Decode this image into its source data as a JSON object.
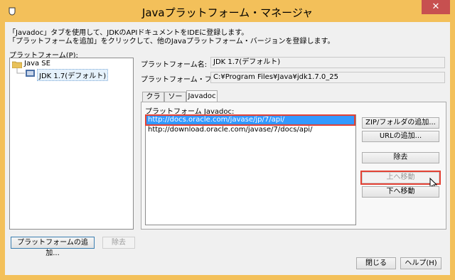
{
  "window": {
    "title": "Javaプラットフォーム・マネージャ",
    "close_glyph": "✕"
  },
  "instructions": {
    "line1": "「Javadoc」タブを使用して、JDKのAPIドキュメントをIDEに登録します。",
    "line2": "「プラットフォームを追加」をクリックして、他のJavaプラットフォーム・バージョンを登録します。"
  },
  "platforms": {
    "label": "プラットフォーム(P):",
    "tree": [
      {
        "label": "Java SE",
        "children": [
          {
            "label": "JDK 1.7(デフォルト)",
            "selected": true
          }
        ]
      }
    ]
  },
  "details": {
    "name_label": "プラットフォーム名:",
    "name_value": "JDK 1.7(デフォルト)",
    "folder_label": "プラットフォーム・フォルダ:",
    "folder_value": "C:¥Program Files¥Java¥jdk1.7.0_25"
  },
  "tabs": [
    {
      "label": "クラス",
      "active": false
    },
    {
      "label": "ソース",
      "active": false
    },
    {
      "label": "Javadoc",
      "active": true
    }
  ],
  "javadoc": {
    "label": "プラットフォーム Javadoc:",
    "items": [
      "http://docs.oracle.com/javase/jp/7/api/",
      "http://download.oracle.com/javase/7/docs/api/"
    ],
    "buttons": {
      "add_zip": "ZIP/フォルダの追加...",
      "add_url": "URLの追加...",
      "remove": "除去",
      "move_up": "上へ移動",
      "move_down": "下へ移動"
    }
  },
  "footer": {
    "add_platform": "プラットフォームの追加...",
    "remove": "除去",
    "close": "閉じる",
    "help": "ヘルプ(H)"
  },
  "colors": {
    "titlebar": "#f3c05a",
    "selection": "#3399ff",
    "highlight": "#e34234"
  }
}
